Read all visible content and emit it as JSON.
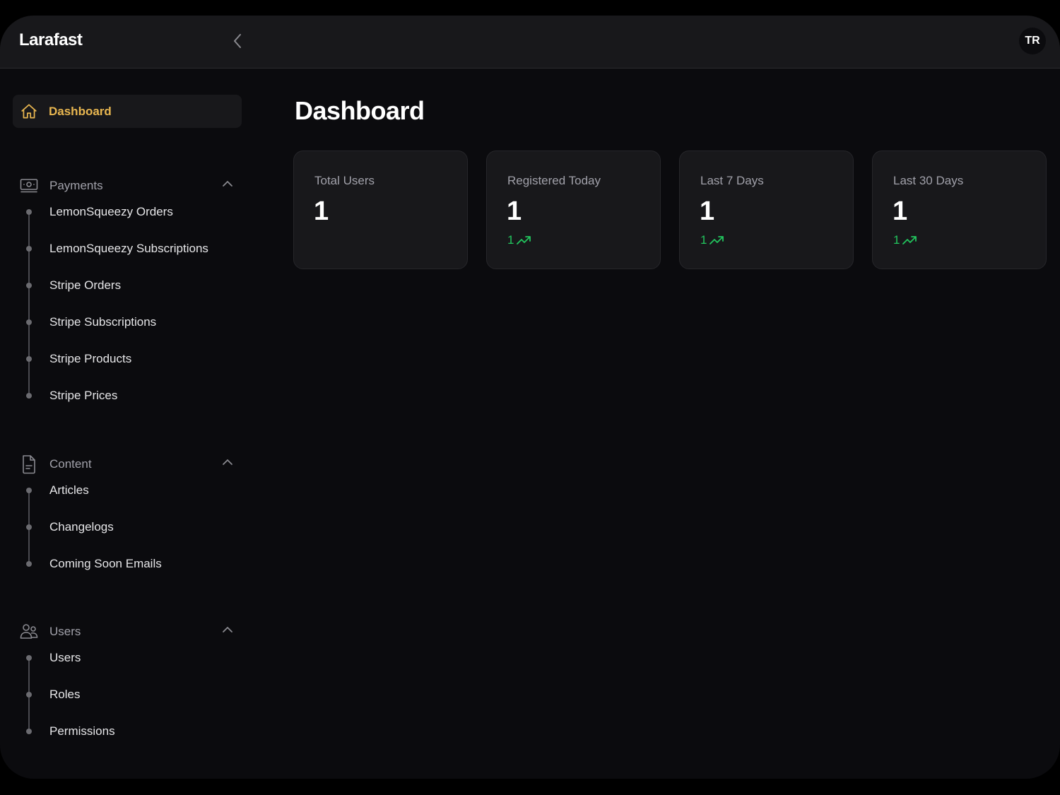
{
  "header": {
    "brand": "Larafast",
    "avatar_initials": "TR"
  },
  "sidebar": {
    "dashboard": {
      "label": "Dashboard",
      "icon": "home-icon",
      "active": true
    },
    "groups": [
      {
        "label": "Payments",
        "icon": "banknotes-icon",
        "expanded": true,
        "items": [
          {
            "label": "LemonSqueezy Orders"
          },
          {
            "label": "LemonSqueezy Subscriptions"
          },
          {
            "label": "Stripe Orders"
          },
          {
            "label": "Stripe Subscriptions"
          },
          {
            "label": "Stripe Products"
          },
          {
            "label": "Stripe Prices"
          }
        ]
      },
      {
        "label": "Content",
        "icon": "document-text-icon",
        "expanded": true,
        "items": [
          {
            "label": "Articles"
          },
          {
            "label": "Changelogs"
          },
          {
            "label": "Coming Soon Emails"
          }
        ]
      },
      {
        "label": "Users",
        "icon": "users-icon",
        "expanded": true,
        "items": [
          {
            "label": "Users"
          },
          {
            "label": "Roles"
          },
          {
            "label": "Permissions"
          }
        ]
      }
    ]
  },
  "main": {
    "title": "Dashboard",
    "stats": [
      {
        "label": "Total Users",
        "value": "1",
        "trend": null
      },
      {
        "label": "Registered Today",
        "value": "1",
        "trend": "1"
      },
      {
        "label": "Last 7 Days",
        "value": "1",
        "trend": "1"
      },
      {
        "label": "Last 30 Days",
        "value": "1",
        "trend": "1"
      }
    ]
  },
  "colors": {
    "accent": "#e8b650",
    "trend_up": "#22c55e",
    "background": "#0b0b0e",
    "surface": "#18181b"
  }
}
